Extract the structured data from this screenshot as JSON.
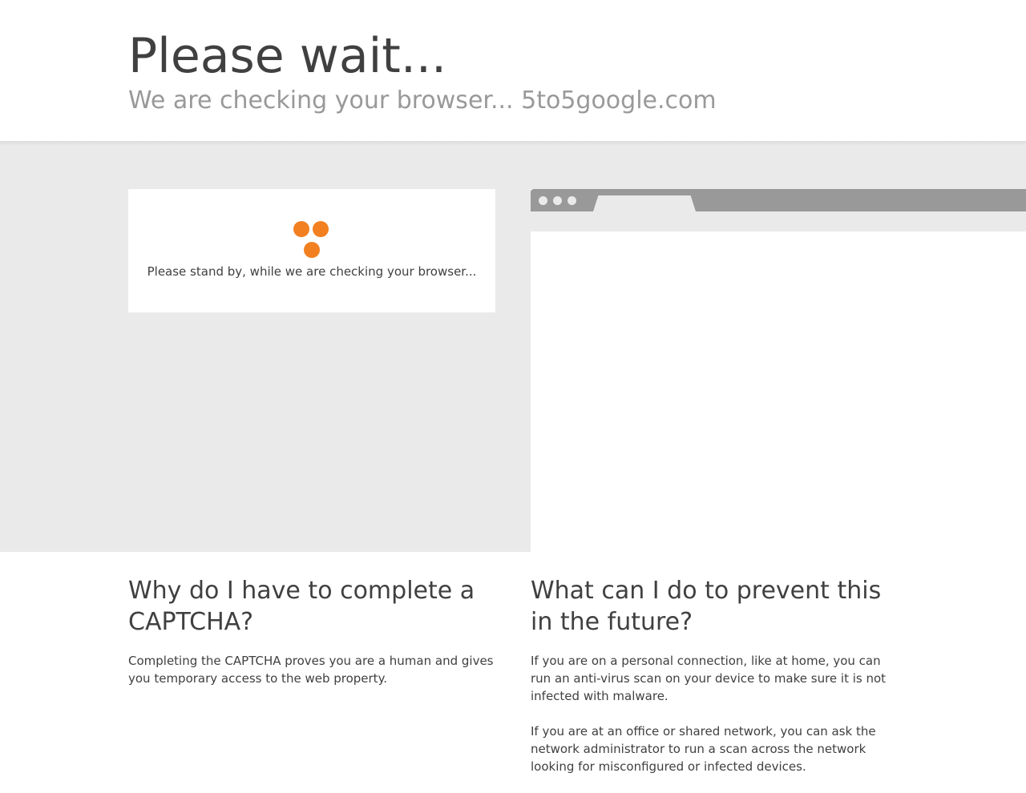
{
  "header": {
    "title": "Please wait...",
    "subtitle": "We are checking your browser... 5to5google.com"
  },
  "check_card": {
    "spinner_icon": "orange-three-dots-spinner",
    "message": "Please stand by, while we are checking your browser..."
  },
  "browser_mock": {
    "bar_icon": "browser-window-dots"
  },
  "info": {
    "why": {
      "heading": "Why do I have to complete a CAPTCHA?",
      "body": "Completing the CAPTCHA proves you are a human and gives you temporary access to the web property."
    },
    "prevent": {
      "heading": "What can I do to prevent this in the future?",
      "body_1": "If you are on a personal connection, like at home, you can run an anti-virus scan on your device to make sure it is not infected with malware.",
      "body_2": "If you are at an office or shared network, you can ask the network administrator to run a scan across the network looking for misconfigured or infected devices."
    }
  },
  "colors": {
    "accent": "#f38020",
    "band": "#eaeaea",
    "text": "#404040",
    "muted": "#999999"
  }
}
